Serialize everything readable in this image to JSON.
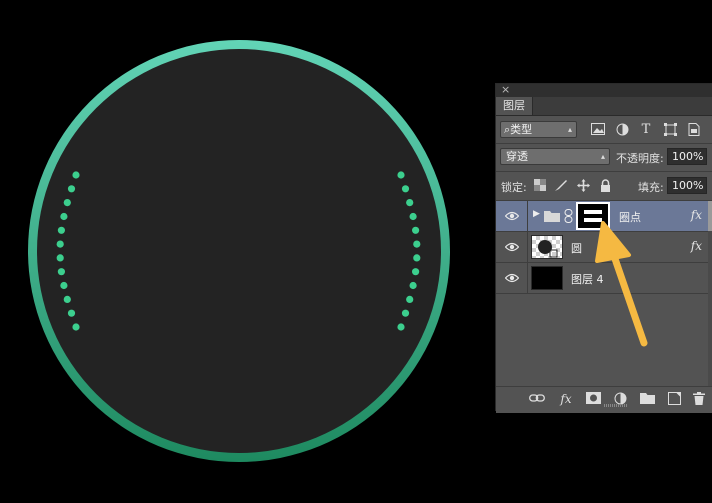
{
  "canvas": {
    "ring_gradient_top": "#62d4b6",
    "ring_gradient_bottom": "#1e8a60",
    "disc_color": "#232323",
    "dot_color": "#3ccf8e"
  },
  "annotation_arrow_color": "#f5b942",
  "panel": {
    "close_icon": "×",
    "tab_label": "图层",
    "filter": {
      "search_icon": "⌕",
      "kind_label": "类型"
    },
    "blend_mode": "穿透",
    "opacity_label": "不透明度:",
    "opacity_value": "100%",
    "lock_label": "锁定:",
    "fill_label": "填充:",
    "fill_value": "100%",
    "layers": [
      {
        "name": "圈点",
        "type": "group",
        "selected": true,
        "has_fx": true,
        "fx_label": "fx"
      },
      {
        "name": "圆",
        "type": "shape",
        "selected": false,
        "has_fx": true,
        "fx_label": "fx"
      },
      {
        "name": "图层 4",
        "type": "fill",
        "selected": false,
        "has_fx": false
      }
    ],
    "bottom_tools": {
      "fx_label": "fx"
    }
  }
}
